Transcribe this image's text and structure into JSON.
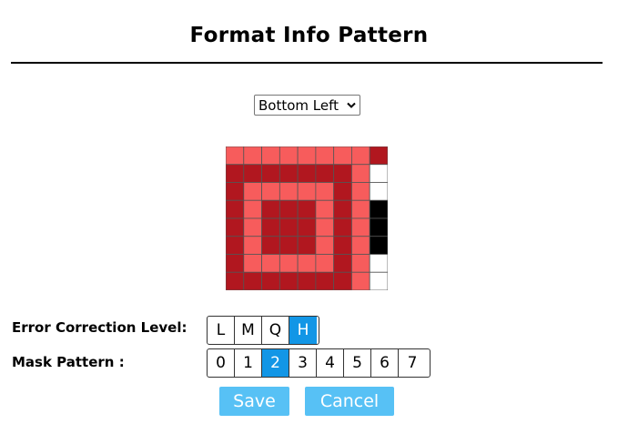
{
  "title": "Format Info Pattern",
  "position_select": {
    "selected": "Bottom Left",
    "icon": "chevron-down-icon"
  },
  "colors": {
    "light_cell": "#f75c5c",
    "dark_cell": "#b1171f",
    "black_cell": "#000000",
    "white_cell": "#ffffff",
    "active": "#1296e6",
    "button": "#57c1f5"
  },
  "pattern": {
    "rows": [
      [
        "L",
        "L",
        "L",
        "L",
        "L",
        "L",
        "L",
        "L",
        "D"
      ],
      [
        "D",
        "D",
        "D",
        "D",
        "D",
        "D",
        "D",
        "L",
        "W"
      ],
      [
        "D",
        "L",
        "L",
        "L",
        "L",
        "L",
        "D",
        "L",
        "W"
      ],
      [
        "D",
        "L",
        "D",
        "D",
        "D",
        "L",
        "D",
        "L",
        "B"
      ],
      [
        "D",
        "L",
        "D",
        "D",
        "D",
        "L",
        "D",
        "L",
        "B"
      ],
      [
        "D",
        "L",
        "D",
        "D",
        "D",
        "L",
        "D",
        "L",
        "B"
      ],
      [
        "D",
        "L",
        "L",
        "L",
        "L",
        "L",
        "D",
        "L",
        "W"
      ],
      [
        "D",
        "D",
        "D",
        "D",
        "D",
        "D",
        "D",
        "L",
        "W"
      ]
    ]
  },
  "error_correction": {
    "label": "Error Correction Level:",
    "options": [
      "L",
      "M",
      "Q",
      "H"
    ],
    "selected": "H"
  },
  "mask_pattern": {
    "label": "Mask Pattern :",
    "options": [
      "0",
      "1",
      "2",
      "3",
      "4",
      "5",
      "6",
      "7"
    ],
    "selected": "2"
  },
  "actions": {
    "save_label": "Save",
    "cancel_label": "Cancel"
  }
}
